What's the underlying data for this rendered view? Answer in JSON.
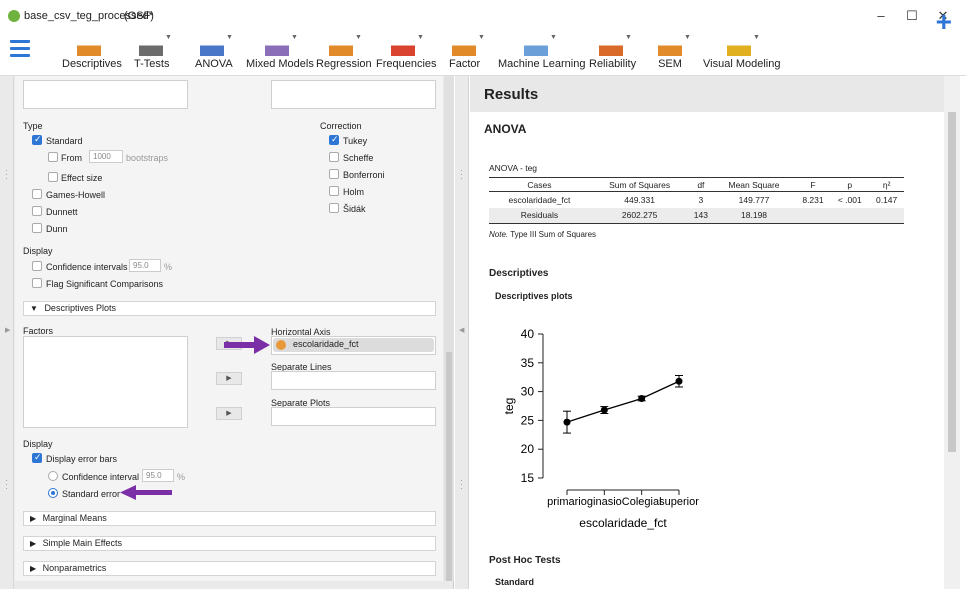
{
  "window": {
    "title": "base_csv_teg_processed*",
    "subtitle": "(OSF)",
    "minimize": "–",
    "maximize": "☐",
    "close": "✕"
  },
  "toolbar": {
    "items": [
      {
        "label": "Descriptives"
      },
      {
        "label": "T-Tests"
      },
      {
        "label": "ANOVA"
      },
      {
        "label": "Mixed Models"
      },
      {
        "label": "Regression"
      },
      {
        "label": "Frequencies"
      },
      {
        "label": "Factor"
      },
      {
        "label": "Machine Learning"
      },
      {
        "label": "Reliability"
      },
      {
        "label": "SEM"
      },
      {
        "label": "Visual Modeling"
      }
    ],
    "plus": "+"
  },
  "options": {
    "type_label": "Type",
    "standard": "Standard",
    "from": "From",
    "bootstraps_value": "1000",
    "bootstraps": "bootstraps",
    "effect_size": "Effect size",
    "games_howell": "Games-Howell",
    "dunnett": "Dunnett",
    "dunn": "Dunn",
    "correction_label": "Correction",
    "tukey": "Tukey",
    "scheffe": "Scheffe",
    "bonferroni": "Bonferroni",
    "holm": "Holm",
    "sidak": "Šidák",
    "display_label": "Display",
    "conf_intervals": "Confidence intervals",
    "conf_value": "95.0",
    "percent": "%",
    "flag_sig": "Flag Significant Comparisons"
  },
  "desc_plots": {
    "header": "Descriptives Plots",
    "factors": "Factors",
    "horizontal_axis": "Horizontal Axis",
    "horizontal_value": "escolaridade_fct",
    "separate_lines": "Separate Lines",
    "separate_plots": "Separate Plots",
    "display": "Display",
    "display_error_bars": "Display error bars",
    "confidence_interval": "Confidence interval",
    "ci_value": "95.0",
    "percent": "%",
    "standard_error": "Standard error"
  },
  "sections": {
    "marginal_means": "Marginal Means",
    "simple_main_effects": "Simple Main Effects",
    "nonparametrics": "Nonparametrics"
  },
  "results": {
    "title": "Results",
    "anova_title": "ANOVA",
    "table_caption": "ANOVA - teg",
    "columns": [
      "Cases",
      "Sum of Squares",
      "df",
      "Mean Square",
      "F",
      "p",
      "η²"
    ],
    "rows": [
      [
        "escolaridade_fct",
        "449.331",
        "3",
        "149.777",
        "8.231",
        "< .001",
        "0.147"
      ],
      [
        "Residuals",
        "2602.275",
        "143",
        "18.198",
        "",
        "",
        ""
      ]
    ],
    "note_label": "Note.",
    "note_text": "Type III Sum of Squares",
    "descriptives": "Descriptives",
    "descriptives_plots": "Descriptives plots",
    "post_hoc": "Post Hoc Tests",
    "standard": "Standard"
  },
  "chart_data": {
    "type": "line",
    "categories": [
      "primario",
      "ginasio",
      "Colegial",
      "superior"
    ],
    "values": [
      24.7,
      26.8,
      28.8,
      31.8
    ],
    "error_low": [
      22.8,
      26.2,
      28.4,
      30.8
    ],
    "error_high": [
      26.6,
      27.4,
      29.2,
      32.8
    ],
    "xlabel": "escolaridade_fct",
    "ylabel": "teg",
    "ylim": [
      15,
      40
    ],
    "yticks": [
      15,
      20,
      25,
      30,
      35,
      40
    ],
    "grid": false
  },
  "colors": {
    "accent": "#2e76d6",
    "arrow": "#7b2fa6"
  }
}
